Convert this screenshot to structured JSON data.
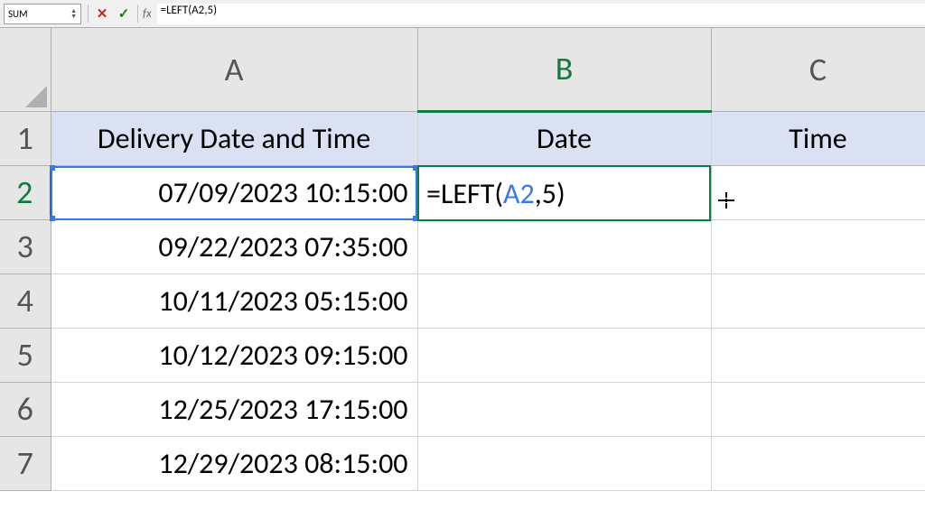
{
  "formula_bar": {
    "name_box": "SUM",
    "formula": "=LEFT(A2,5)"
  },
  "columns": [
    "A",
    "B",
    "C"
  ],
  "rows": [
    "1",
    "2",
    "3",
    "4",
    "5",
    "6",
    "7"
  ],
  "headers": {
    "A": "Delivery Date and Time",
    "B": "Date",
    "C": "Time"
  },
  "data": {
    "A2": "07/09/2023 10:15:00",
    "A3": "09/22/2023 07:35:00",
    "A4": "10/11/2023 05:15:00",
    "A5": "10/12/2023 09:15:00",
    "A6": "12/25/2023 17:15:00",
    "A7": "12/29/2023 08:15:00"
  },
  "editing_cell": {
    "address": "B2",
    "parts": {
      "prefix": "=LEFT(",
      "ref": "A2",
      "suffix": ",5)"
    },
    "referenced_cell": "A2"
  },
  "active_row": "2",
  "active_col": "B"
}
